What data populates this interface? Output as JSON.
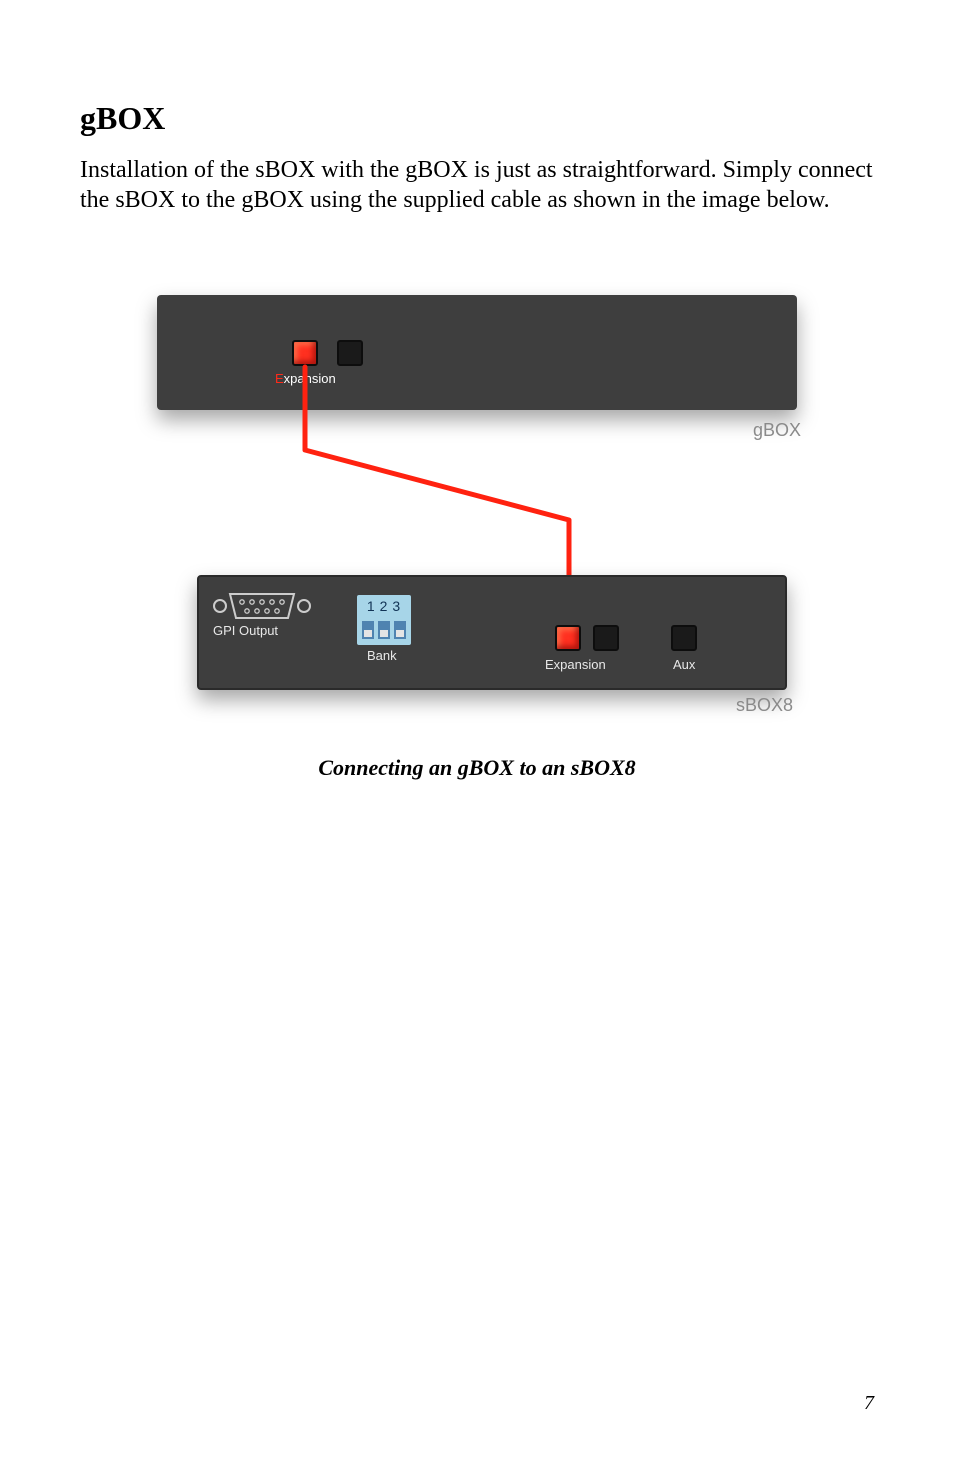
{
  "heading": "gBOX",
  "paragraph": "Installation of the sBOX with the gBOX is just as straightforward. Simply connect the sBOX to the gBOX using the supplied cable as shown in the image below.",
  "diagram": {
    "gbox": {
      "label": "gBOX",
      "expansion_label_e": "E",
      "expansion_label_rest": "xpansion"
    },
    "sbox": {
      "label": "sBOX8",
      "gpi_output_label": "GPI Output",
      "bank_label": "Bank",
      "bank_numbers": "123",
      "expansion_label": "Expansion",
      "aux_label": "Aux"
    }
  },
  "caption": "Connecting an gBOX to an sBOX8",
  "page_number": "7"
}
